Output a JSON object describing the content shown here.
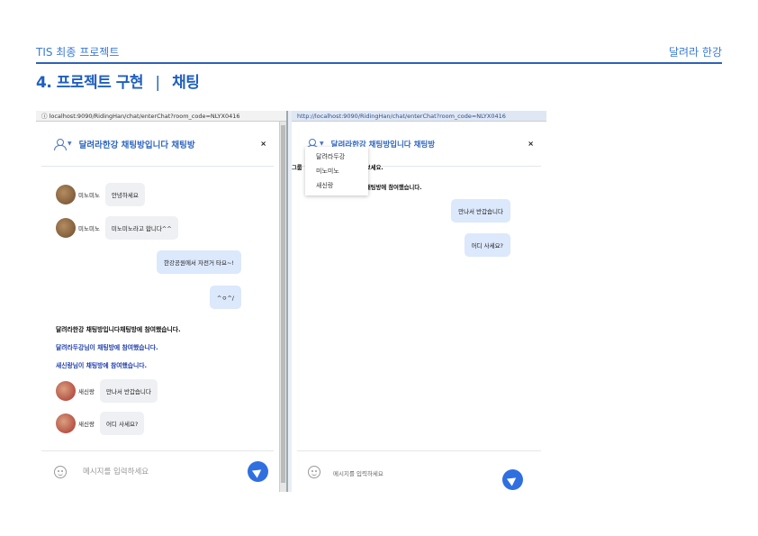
{
  "header": {
    "left": "TIS 최종 프로젝트",
    "right": "달려라 한강"
  },
  "section": {
    "number": "4.",
    "title": "프로젝트 구현",
    "separator": "|",
    "subtitle": "채팅"
  },
  "left_window": {
    "address": "ⓘ localhost:9090/RidingHan/chat/enterChat?room_code=NLYX0416",
    "room_title": "달려라한강 채팅방입니다 채팅방",
    "close": "×",
    "messages": [
      {
        "name": "미노미노",
        "text": "안녕하세요"
      },
      {
        "name": "미노미노",
        "text": "미노미노라고 합니다^^"
      }
    ],
    "mine": [
      "한강공원에서 자전거 타요~!",
      "^ㅇ^/"
    ],
    "notices": [
      "달려라한강 채팅방입니다채팅방에 참여했습니다.",
      "달려라두강님이 채팅방에 참여했습니다.",
      "새신랑님이 채팅방에 참여했습니다."
    ],
    "messages2": [
      {
        "name": "새신랑",
        "text": "만나서 반갑습니다"
      },
      {
        "name": "새신랑",
        "text": "어디 사세요?"
      }
    ],
    "placeholder": "메시지를 입력하세요"
  },
  "right_window": {
    "address": "http://localhost:9090/RidingHan/chat/enterChat?room_code=NLYX0416",
    "room_title": "달려라한강 채팅방입니다 채팅방",
    "close": "×",
    "dropdown": [
      "달려라두강",
      "미노미노",
      "새신랑"
    ],
    "clipped": [
      "그룹",
      "보세요.",
      "채팅방에 참여했습니다."
    ],
    "mine": [
      "만나서 반갑습니다",
      "어디 사세요?"
    ],
    "placeholder": "메시지를 입력하세요"
  }
}
